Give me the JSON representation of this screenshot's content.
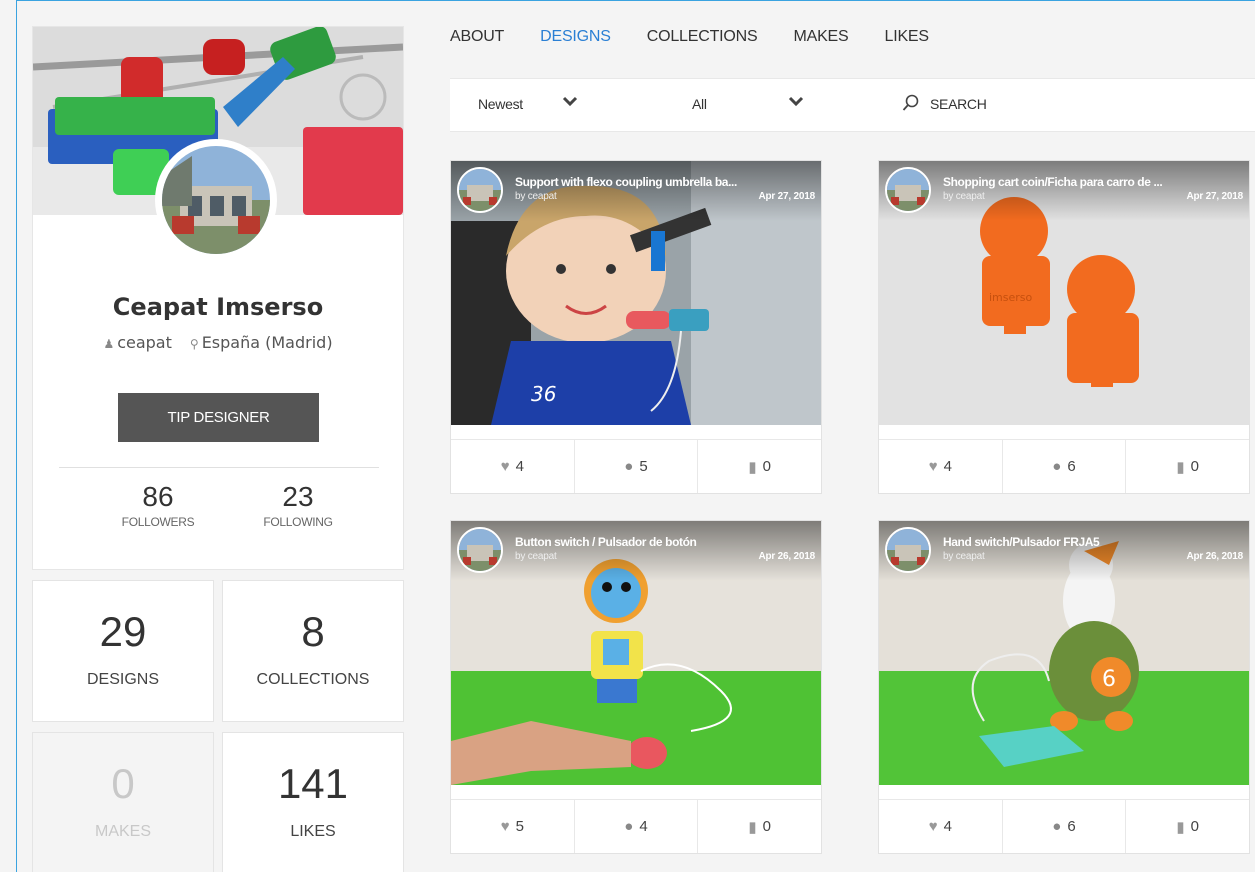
{
  "profile": {
    "name": "Ceapat Imserso",
    "username": "ceapat",
    "location": "España (Madrid)",
    "tip_button": "TIP DESIGNER",
    "followers": {
      "count": "86",
      "label": "FOLLOWERS"
    },
    "following": {
      "count": "23",
      "label": "FOLLOWING"
    }
  },
  "stats": {
    "designs": {
      "count": "29",
      "label": "DESIGNS"
    },
    "collections": {
      "count": "8",
      "label": "COLLECTIONS"
    },
    "makes": {
      "count": "0",
      "label": "MAKES"
    },
    "likes": {
      "count": "141",
      "label": "LIKES"
    }
  },
  "tabs": [
    {
      "label": "ABOUT"
    },
    {
      "label": "DESIGNS",
      "active": true
    },
    {
      "label": "COLLECTIONS"
    },
    {
      "label": "MAKES"
    },
    {
      "label": "LIKES"
    }
  ],
  "filters": {
    "sort": "Newest",
    "category": "All",
    "search_label": "SEARCH"
  },
  "cards": [
    {
      "title": "Support with flexo coupling umbrella ba...",
      "by": "by ceapat",
      "date": "Apr 27, 2018",
      "likes": "4",
      "makes": "5",
      "comments": "0"
    },
    {
      "title": "Shopping cart coin/Ficha para carro de ...",
      "by": "by ceapat",
      "date": "Apr 27, 2018",
      "likes": "4",
      "makes": "6",
      "comments": "0"
    },
    {
      "title": "Button switch / Pulsador de botón",
      "by": "by ceapat",
      "date": "Apr 26, 2018",
      "likes": "5",
      "makes": "4",
      "comments": "0"
    },
    {
      "title": "Hand switch/Pulsador FRJA5",
      "by": "by ceapat",
      "date": "Apr 26, 2018",
      "likes": "4",
      "makes": "6",
      "comments": "0"
    }
  ],
  "colors": {
    "accent": "#2a7fd4",
    "tip_button_bg": "#555555",
    "frame_border": "#3aa3e0"
  },
  "icons": {
    "username": "user-group-icon",
    "location": "map-pin-icon",
    "sort_chevron": "chevron-down-icon",
    "search": "search-icon",
    "like": "heart-icon",
    "make": "make-icon",
    "comment": "comment-icon"
  }
}
